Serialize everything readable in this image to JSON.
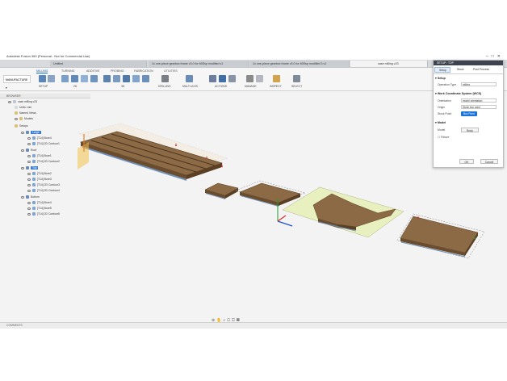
{
  "app": {
    "title": "Autodesk Fusion 360 (Personal - Not for Commercial Use)"
  },
  "tabs": [
    {
      "label": "Untitled"
    },
    {
      "label": "1x one-piece gearbox frame v3.0 for 60Ssp modified v1"
    },
    {
      "label": "1x one-piece gearbox frame v3.0 for 60Ssp modified 3 v1"
    },
    {
      "label": "case milling v23",
      "active": true
    }
  ],
  "ribbon": {
    "workspace": "MANUFACTURE",
    "tabs": [
      "MILLING",
      "TURNING",
      "ADDITIVE",
      "PROBING",
      "FABRICATION",
      "UTILITIES"
    ],
    "groups": [
      "SETUP",
      "2D",
      "3D",
      "DRILLING",
      "MULTI-AXIS",
      "ACTIONS",
      "MANAGE",
      "INSPECT",
      "SELECT"
    ]
  },
  "browser": {
    "header": "BROWSER",
    "nodes": [
      {
        "label": "case milling v23"
      },
      {
        "label": "Units: mm"
      },
      {
        "label": "Named Views"
      },
      {
        "label": "Models"
      },
      {
        "label": "Setups"
      },
      {
        "label": "Large",
        "selected": true
      },
      {
        "label": "[T14] Bore4"
      },
      {
        "label": "[T14] 2D Contour1"
      },
      {
        "label": "Roof"
      },
      {
        "label": "[T14] Bore1"
      },
      {
        "label": "[T14] 2D Contour2"
      },
      {
        "label": "Top",
        "selected": true
      },
      {
        "label": "[T14] Bore2"
      },
      {
        "label": "[T14] Bore3"
      },
      {
        "label": "[T14] 2D Contour3"
      },
      {
        "label": "[T14] 2D Contour4"
      },
      {
        "label": "Bottom"
      },
      {
        "label": "[T14] Bore4"
      },
      {
        "label": "[T14] Bore5"
      },
      {
        "label": "[T14] 2D Contour5"
      }
    ]
  },
  "panel": {
    "title": "SETUP : TOP",
    "tabs": [
      "Setup",
      "Stock",
      "Post Process"
    ],
    "setup_section": "Setup",
    "operation_type_label": "Operation Type",
    "operation_type_value": "milling",
    "wcs_section": "Work Coordinate System (WCS)",
    "orientation_label": "Orientation",
    "orientation_value": "model orientation",
    "origin_label": "Origin",
    "origin_value": "Stock box point",
    "stock_point_label": "Stock Point",
    "stock_point_value": "Box Point",
    "model_section": "Model",
    "model_label": "Model",
    "model_value": "Body",
    "fixture_label": "Fixture",
    "ok": "OK",
    "cancel": "Cancel"
  },
  "bottom": {
    "comments": "COMMENTS"
  },
  "colors": {
    "wood": "#8b6a45",
    "wood_dark": "#6a4d2e",
    "accent": "#0b66c3",
    "base": "#6f8fb8"
  }
}
